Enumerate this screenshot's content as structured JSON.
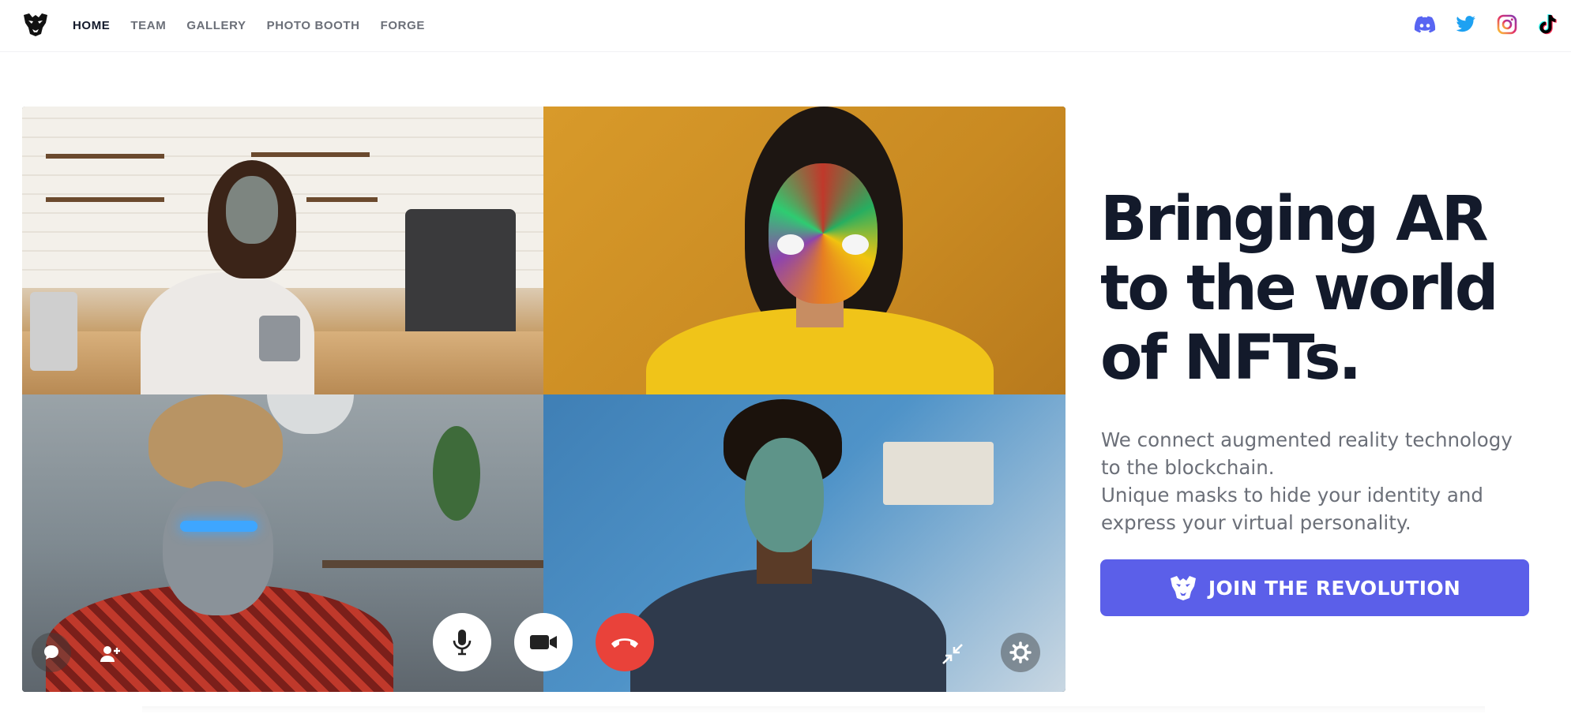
{
  "nav": {
    "logo": "ar-mask-logo-icon",
    "links": [
      {
        "label": "HOME",
        "active": true
      },
      {
        "label": "TEAM",
        "active": false
      },
      {
        "label": "GALLERY",
        "active": false
      },
      {
        "label": "PHOTO BOOTH",
        "active": false
      },
      {
        "label": "FORGE",
        "active": false
      }
    ],
    "social": [
      {
        "name": "discord-icon",
        "color": "#5865F2"
      },
      {
        "name": "twitter-icon",
        "color": "#1DA1F2"
      },
      {
        "name": "instagram-icon",
        "color": "#E1306C"
      },
      {
        "name": "tiktok-icon",
        "color": "#000000"
      }
    ]
  },
  "video_call": {
    "participants": [
      {
        "scene": "kitchen",
        "mask": "grey-stone-mask"
      },
      {
        "scene": "yellow-wall",
        "mask": "multicolor-paint-mask"
      },
      {
        "scene": "living-room",
        "mask": "cyber-visor-mask"
      },
      {
        "scene": "blue-wall",
        "mask": "teal-marble-mask"
      }
    ],
    "controls": [
      {
        "name": "chat-icon"
      },
      {
        "name": "add-person-icon"
      },
      {
        "name": "microphone-icon"
      },
      {
        "name": "video-camera-icon"
      },
      {
        "name": "end-call-icon",
        "color": "#E9423A"
      },
      {
        "name": "minimize-icon"
      },
      {
        "name": "settings-gear-icon"
      }
    ]
  },
  "hero": {
    "headline_line1": "Bringing AR",
    "headline_line2": "to the world",
    "headline_line3": "of NFTs.",
    "sub_line1": "We connect augmented reality technology",
    "sub_line2": "to the blockchain.",
    "sub_line3": "Unique masks to hide your identity and",
    "sub_line4": "express your virtual personality.",
    "cta_label": "JOIN THE REVOLUTION",
    "cta_icon": "mask-icon",
    "cta_color": "#5B5FE9"
  }
}
